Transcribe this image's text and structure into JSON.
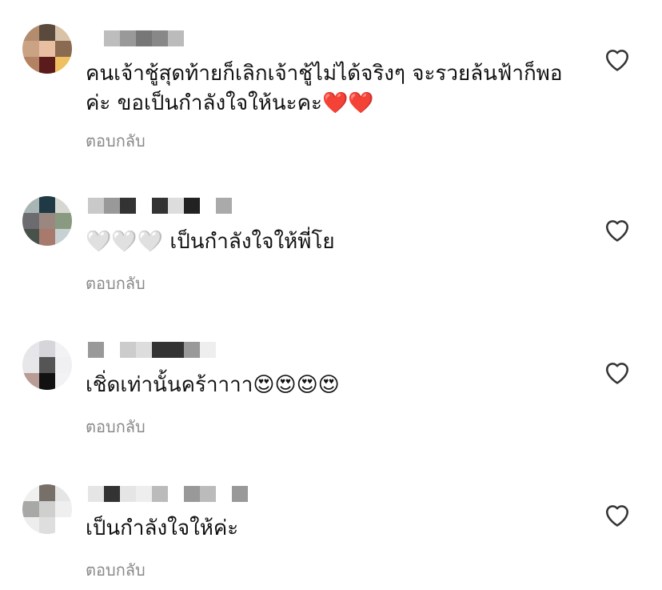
{
  "comments": [
    {
      "text": "คนเจ้าชู้สุดท้ายก็เลิกเจ้าชู้ไม่ได้จริงๆ จะรวยล้นฟ้าก็พอค่ะ ขอเป็นกำลังใจให้นะคะ",
      "emoji": "❤️❤️",
      "reply": "ตอบกลับ",
      "avatar_colors": [
        "#b38b6d",
        "#5a4a3e",
        "#d9c2a7",
        "#c9a384",
        "#e8bfa0",
        "#8b6a52",
        "#b38263",
        "#5b1b1b",
        "#f0c060"
      ],
      "username_blocks": [
        "#ffffff",
        "#bdbdbd",
        "#999999",
        "#777777",
        "#888888",
        "#bbbbbb"
      ]
    },
    {
      "text": "เป็นกำลังใจให้พี่โย",
      "emoji_prefix": "🤍🤍🤍",
      "reply": "ตอบกลับ",
      "avatar_colors": [
        "#a9b5b5",
        "#1f3a44",
        "#d7d7d2",
        "#6b6b70",
        "#9a8880",
        "#8a9a80",
        "#48514a",
        "#a77a6d",
        "#c7d1d3"
      ],
      "username_blocks": [
        "#c9c9c9",
        "#999999",
        "#333333",
        "#ffffff",
        "#333333",
        "#dddddd",
        "#222222",
        "#ffffff",
        "#aaaaaa"
      ]
    },
    {
      "text": "เชิ่ดเท่านั้นคร้าาาา",
      "emoji": "😍😍😍😍",
      "reply": "ตอบกลับ",
      "avatar_colors": [
        "#e6e6ea",
        "#d6d6da",
        "#f2f2f4",
        "#e7e7ea",
        "#555555",
        "#f0f0f2",
        "#b99c95",
        "#111111",
        "#f2f2f4"
      ],
      "username_blocks": [
        "#999999",
        "#ffffff",
        "#cccccc",
        "#dddddd",
        "#333333",
        "#333333",
        "#999999",
        "#eeeeee"
      ]
    },
    {
      "text": "เป็นกำลังใจให้ค่ะ",
      "reply": "ตอบกลับ",
      "avatar_colors": [
        "#f0f0f0",
        "#777068",
        "#e5e5e5",
        "#a8a8a6",
        "#cfcfcd",
        "#efefef",
        "#ededed",
        "#dedede",
        "#ffffff"
      ],
      "username_blocks": [
        "#e5e5e5",
        "#333333",
        "#e5e5e5",
        "#eeeeee",
        "#bbbbbb",
        "#ffffff",
        "#999999",
        "#bbbbbb",
        "#ffffff",
        "#999999"
      ]
    }
  ]
}
